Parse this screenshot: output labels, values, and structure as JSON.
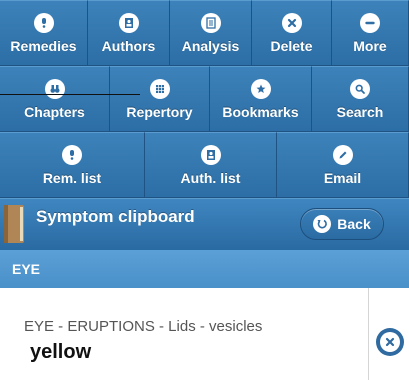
{
  "toolbar": {
    "row1": [
      {
        "label": "Remedies",
        "icon": "remedy-icon"
      },
      {
        "label": "Authors",
        "icon": "person-icon"
      },
      {
        "label": "Analysis",
        "icon": "grid-list-icon"
      },
      {
        "label": "Delete",
        "icon": "close-icon"
      },
      {
        "label": "More",
        "icon": "minus-icon"
      }
    ],
    "row2": [
      {
        "label": "Chapters",
        "icon": "binoculars-icon"
      },
      {
        "label": "Repertory",
        "icon": "grid-icon"
      },
      {
        "label": "Bookmarks",
        "icon": "star-icon"
      },
      {
        "label": "Search",
        "icon": "search-icon"
      }
    ],
    "row3": [
      {
        "label": "Rem. list",
        "icon": "remedy-icon"
      },
      {
        "label": "Auth. list",
        "icon": "person-icon"
      },
      {
        "label": "Email",
        "icon": "pencil-icon"
      }
    ]
  },
  "clipboard": {
    "title": "Symptom clipboard",
    "back_label": "Back"
  },
  "section": {
    "title": "EYE"
  },
  "items": [
    {
      "path": "EYE - ERUPTIONS - Lids - vesicles",
      "detail": "yellow"
    }
  ],
  "colors": {
    "toolbar_blue": "#2f6ea5",
    "section_blue": "#4a90c9",
    "delete_blue": "#2f6aa0"
  }
}
